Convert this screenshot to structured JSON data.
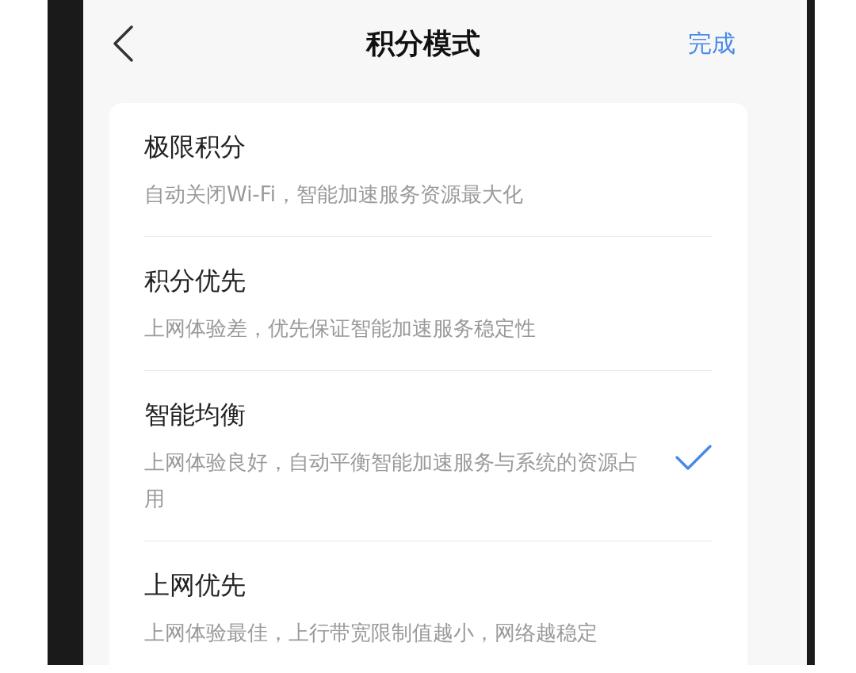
{
  "nav": {
    "title": "积分模式",
    "done": "完成"
  },
  "options": [
    {
      "title": "极限积分",
      "description": "自动关闭Wi-Fi，智能加速服务资源最大化",
      "selected": false
    },
    {
      "title": "积分优先",
      "description": "上网体验差，优先保证智能加速服务稳定性",
      "selected": false
    },
    {
      "title": "智能均衡",
      "description": "上网体验良好，自动平衡智能加速服务与系统的资源占用",
      "selected": true
    },
    {
      "title": "上网优先",
      "description": "上网体验最佳，上行带宽限制值越小，网络越稳定",
      "selected": false
    }
  ]
}
